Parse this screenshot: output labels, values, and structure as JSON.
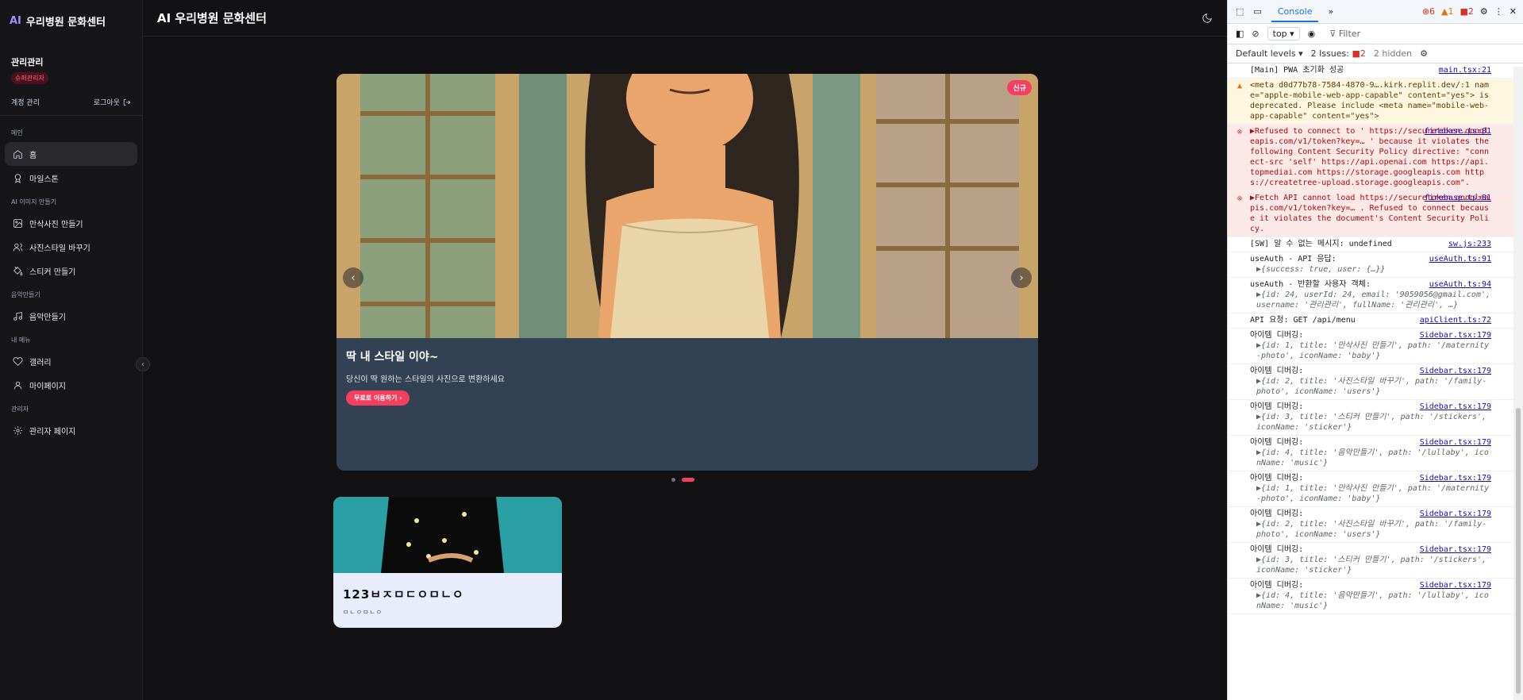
{
  "app": {
    "brand_ai": "AI",
    "brand_name": "우리병원 문화센터",
    "header_title": "AI 우리병원 문화센터",
    "profile": {
      "name": "관리관리",
      "role": "슈퍼관리자"
    },
    "account": {
      "label": "계정 관리",
      "logout": "로그아웃"
    },
    "sections": [
      {
        "label": "메인",
        "items": [
          {
            "label": "홈",
            "icon": "home-icon",
            "active": true
          },
          {
            "label": "마일스톤",
            "icon": "award-icon"
          }
        ]
      },
      {
        "label": "AI 이미지 만들기",
        "items": [
          {
            "label": "만삭사진 만들기",
            "icon": "image-plus-icon"
          },
          {
            "label": "사진스타일 바꾸기",
            "icon": "users-icon"
          },
          {
            "label": "스티커 만들기",
            "icon": "paint-bucket-icon"
          }
        ]
      },
      {
        "label": "음악만들기",
        "items": [
          {
            "label": "음악만들기",
            "icon": "music-icon"
          }
        ]
      },
      {
        "label": "내 메뉴",
        "items": [
          {
            "label": "갤러리",
            "icon": "heart-icon"
          },
          {
            "label": "마이페이지",
            "icon": "user-icon"
          }
        ]
      },
      {
        "label": "관리자",
        "items": [
          {
            "label": "관리자 페이지",
            "icon": "gear-icon"
          }
        ]
      }
    ],
    "carousel": {
      "badge": "신규",
      "heading": "딱 내 스타일 이야~",
      "text": "당신이 딱 원하는 스타일의 사진으로 변환하세요",
      "cta": "무료로 이용하기 ›",
      "prev": "‹",
      "next": "›",
      "active_index": 1,
      "count": 2
    },
    "card": {
      "title": "123ㅂㅈㅁㄷㅇㅁㄴㅇ",
      "subtitle": "ㅁㄴㅇㅁㄴㅇ"
    }
  },
  "devtools": {
    "tab": "Console",
    "counts": {
      "errors": "6",
      "warnings": "1",
      "issues": "2"
    },
    "context": "top ▾",
    "filter": "Filter",
    "levels": "Default levels ▾",
    "issues_label": "2 Issues:",
    "issues_count": "2",
    "hidden": "2 hidden",
    "logs": [
      {
        "type": "log",
        "text": "[Main] PWA 초기화 성공",
        "src": "main.tsx:21"
      },
      {
        "type": "warn",
        "text": "<meta d0d77b78-7584-4870-9….kirk.replit.dev/:1 name=\"apple-mobile-web-app-capable\" content=\"yes\"> is deprecated. Please include <meta name=\"mobile-web-app-capable\" content=\"yes\">",
        "src": ""
      },
      {
        "type": "err",
        "text": "▶Refused to connect to ' https://securetoken.googleapis.com/v1/token?key=… ' because it violates the following Content Security Policy directive: \"connect-src 'self' https://api.openai.com https://api.topmediai.com https://storage.googleapis.com https://createtree-upload.storage.googleapis.com\".",
        "src": "firebase.ts:81"
      },
      {
        "type": "err",
        "text": "▶Fetch API cannot load https://securetoken.googleapis.com/v1/token?key=… . Refused to connect because it violates the document's Content Security Policy.",
        "src": "firebase.ts:81"
      },
      {
        "type": "log",
        "text": "[SW] 알 수 없는 메시지: undefined",
        "src": "sw.js:233"
      },
      {
        "type": "log",
        "text": "useAuth - API 응답:",
        "src": "useAuth.ts:91",
        "obj": "▶{success: true, user: {…}}"
      },
      {
        "type": "log",
        "text": "useAuth - 반환할 사용자 객체:",
        "src": "useAuth.ts:94",
        "obj": "▶{id: 24, userId: 24, email: '9059056@gmail.com', username: '관리관리', fullName: '관리관리', …}"
      },
      {
        "type": "log",
        "text": "API 요청: GET /api/menu",
        "src": "apiClient.ts:72"
      },
      {
        "type": "log",
        "text": "아이템 디버깅:",
        "src": "Sidebar.tsx:179",
        "obj": "▶{id: 1, title: '만삭사진 만들기', path: '/maternity-photo', iconName: 'baby'}"
      },
      {
        "type": "log",
        "text": "아이템 디버깅:",
        "src": "Sidebar.tsx:179",
        "obj": "▶{id: 2, title: '사진스타일 바꾸기', path: '/family-photo', iconName: 'users'}"
      },
      {
        "type": "log",
        "text": "아이템 디버깅:",
        "src": "Sidebar.tsx:179",
        "obj": "▶{id: 3, title: '스티커 만들기', path: '/stickers', iconName: 'sticker'}"
      },
      {
        "type": "log",
        "text": "아이템 디버깅:",
        "src": "Sidebar.tsx:179",
        "obj": "▶{id: 4, title: '음악만들기', path: '/lullaby', iconName: 'music'}"
      },
      {
        "type": "log",
        "text": "아이템 디버깅:",
        "src": "Sidebar.tsx:179",
        "obj": "▶{id: 1, title: '만삭사진 만들기', path: '/maternity-photo', iconName: 'baby'}"
      },
      {
        "type": "log",
        "text": "아이템 디버깅:",
        "src": "Sidebar.tsx:179",
        "obj": "▶{id: 2, title: '사진스타일 바꾸기', path: '/family-photo', iconName: 'users'}"
      },
      {
        "type": "log",
        "text": "아이템 디버깅:",
        "src": "Sidebar.tsx:179",
        "obj": "▶{id: 3, title: '스티커 만들기', path: '/stickers', iconName: 'sticker'}"
      },
      {
        "type": "log",
        "text": "아이템 디버깅:",
        "src": "Sidebar.tsx:179",
        "obj": "▶{id: 4, title: '음악만들기', path: '/lullaby', iconName: 'music'}"
      }
    ]
  },
  "colors": {
    "accent": "#f43f5e",
    "brand": "#a78bfa",
    "bg": "#121214"
  }
}
